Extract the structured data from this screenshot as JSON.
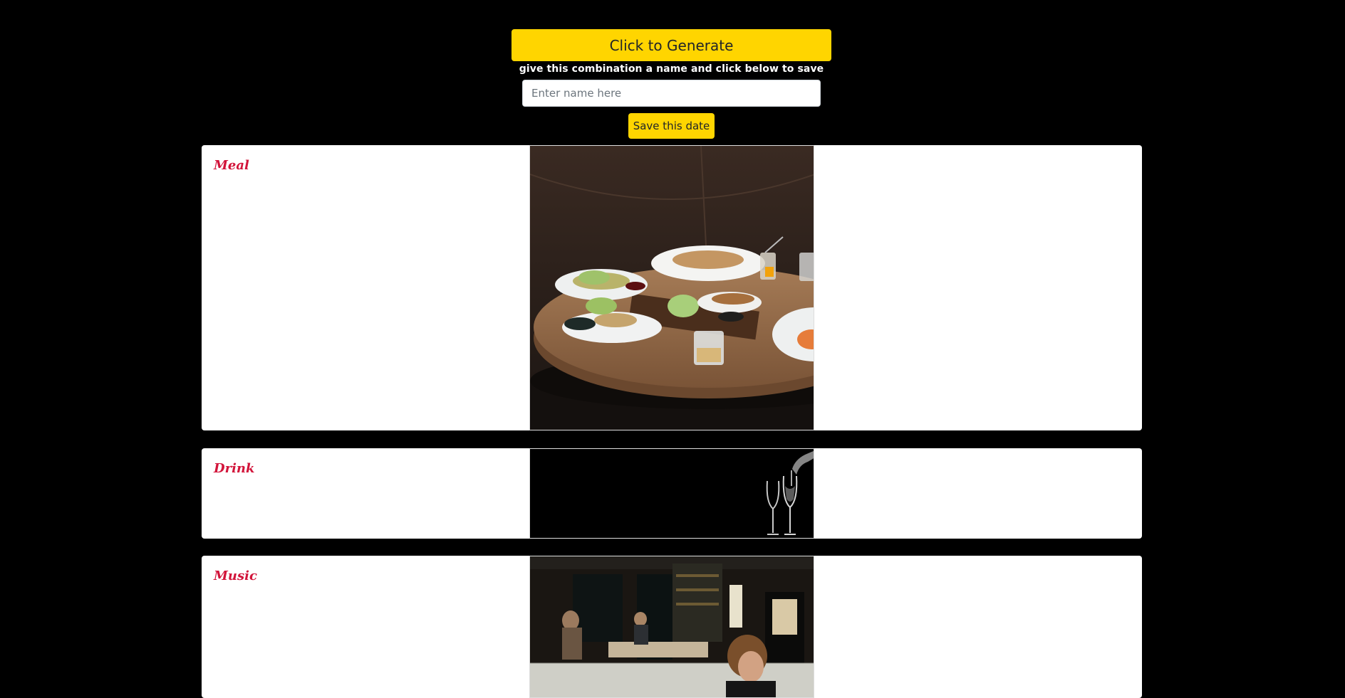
{
  "header": {
    "generate_label": "Click to Generate",
    "save_hint": "give this combination a name and click below to save",
    "name_placeholder": "Enter name here",
    "name_value": "",
    "save_label": "Save this date"
  },
  "cards": [
    {
      "title": "Meal",
      "image": "restaurant-table-with-plates"
    },
    {
      "title": "Drink",
      "image": "champagne-glasses-pour"
    },
    {
      "title": "Music",
      "image": "bar-with-pianist"
    }
  ],
  "colors": {
    "accent": "#ffd500",
    "title": "#d2143a",
    "background": "#000000"
  }
}
